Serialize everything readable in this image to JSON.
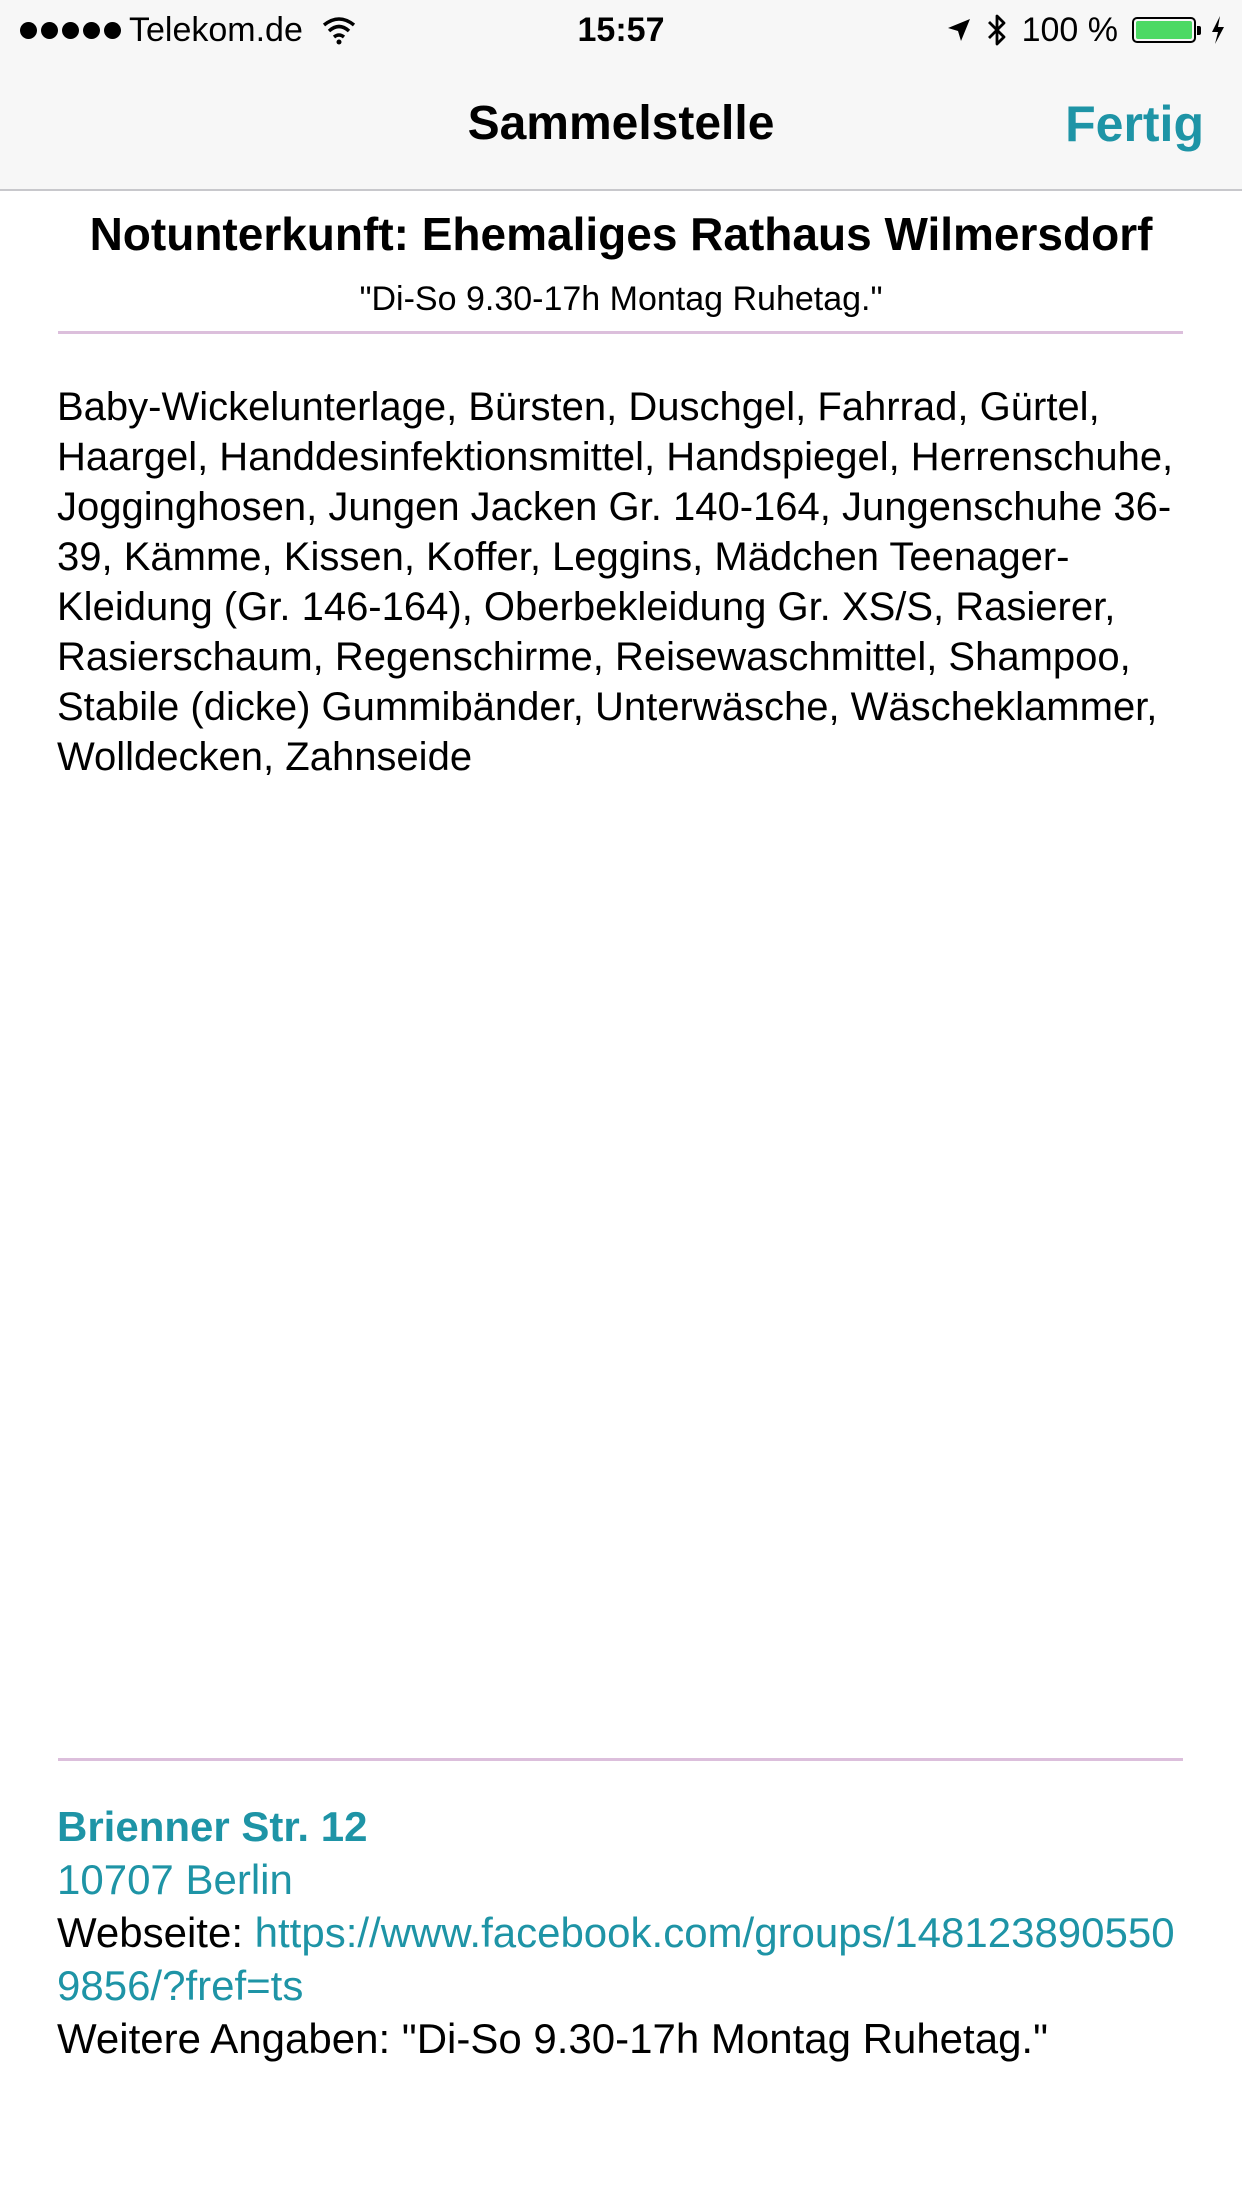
{
  "status_bar": {
    "carrier": "Telekom.de",
    "time": "15:57",
    "battery": "100 %",
    "icons": [
      "signal-dots-icon",
      "wifi-icon",
      "location-arrow-icon",
      "bluetooth-icon",
      "battery-icon",
      "charging-bolt-icon"
    ],
    "battery_color": "#4cd964"
  },
  "nav": {
    "title": "Sammelstelle",
    "done_label": "Fertig",
    "accent_color": "#1e94a6"
  },
  "location": {
    "title": "Notunterkunft: Ehemaliges Rathaus Wilmersdorf",
    "hours_note": "\"Di-So 9.30-17h Montag Ruhetag.\"",
    "items_text": "Baby-Wickelunterlage, Bürsten, Duschgel, Fahrrad, Gürtel, Haargel, Handdesinfektionsmittel, Handspiegel, Herrenschuhe, Jogginghosen, Jungen Jacken Gr. 140-164, Jungenschuhe 36-39, Kämme, Kissen, Koffer, Leggins, Mädchen Teenager-Kleidung (Gr. 146-164), Oberbekleidung Gr. XS/S, Rasierer, Rasierschaum, Regenschirme, Reisewaschmittel, Shampoo, Stabile (dicke) Gummibänder, Unterwäsche, Wäscheklammer, Wolldecken, Zahnseide"
  },
  "address": {
    "street": "Brienner Str. 12",
    "city": "10707 Berlin",
    "website_label": "Webseite: ",
    "website_url": "https://www.facebook.com/groups/1481238905509856/?fref=ts",
    "more_info": "Weitere Angaben: \"Di-So 9.30-17h Montag Ruhetag.\""
  }
}
